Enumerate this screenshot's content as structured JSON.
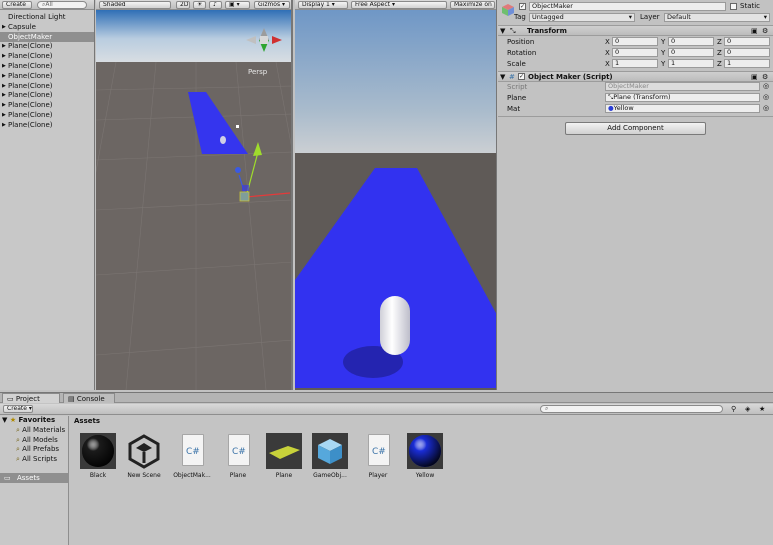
{
  "hierarchy": {
    "create_label": "Create",
    "search_placeholder": "All",
    "items": [
      {
        "label": "Directional Light",
        "arrow": ""
      },
      {
        "label": "Capsule",
        "arrow": "▶"
      },
      {
        "label": "ObjectMaker",
        "arrow": ""
      },
      {
        "label": "Plane(Clone)",
        "arrow": "▶"
      },
      {
        "label": "Plane(Clone)",
        "arrow": "▶"
      },
      {
        "label": "Plane(Clone)",
        "arrow": "▶"
      },
      {
        "label": "Plane(Clone)",
        "arrow": "▶"
      },
      {
        "label": "Plane(Clone)",
        "arrow": "▶"
      },
      {
        "label": "Plane(Clone)",
        "arrow": "▶"
      },
      {
        "label": "Plane(Clone)",
        "arrow": "▶"
      },
      {
        "label": "Plane(Clone)",
        "arrow": "▶"
      },
      {
        "label": "Plane(Clone)",
        "arrow": "▶"
      }
    ]
  },
  "scene": {
    "shading": "Shaded",
    "mode2d": "2D",
    "gizmos": "Gizmos",
    "persp": "Persp"
  },
  "game": {
    "display": "Display 1",
    "aspect": "Free Aspect",
    "maximize": "Maximize on P"
  },
  "inspector": {
    "object_name": "ObjectMaker",
    "static_label": "Static",
    "tag_label": "Tag",
    "tag_value": "Untagged",
    "layer_label": "Layer",
    "layer_value": "Default",
    "transform": {
      "title": "Transform",
      "position": {
        "label": "Position",
        "x": "0",
        "y": "0",
        "z": "0"
      },
      "rotation": {
        "label": "Rotation",
        "x": "0",
        "y": "0",
        "z": "0"
      },
      "scale": {
        "label": "Scale",
        "x": "1",
        "y": "1",
        "z": "1"
      }
    },
    "script_comp": {
      "title": "Object Maker (Script)",
      "script_label": "Script",
      "script_value": "ObjectMaker",
      "plane_label": "Plane",
      "plane_value": "Plane (Transform)",
      "mat_label": "Mat",
      "mat_value": "Yellow"
    },
    "add_component": "Add Component"
  },
  "project": {
    "tab_project": "Project",
    "tab_console": "Console",
    "create_label": "Create",
    "favorites_title": "Favorites",
    "favorites": [
      "All Materials",
      "All Models",
      "All Prefabs",
      "All Scripts"
    ],
    "assets_folder": "Assets",
    "breadcrumb": "Assets",
    "assets": [
      {
        "name": "Black",
        "kind": "sphere",
        "color": "#1b1b1b"
      },
      {
        "name": "New Scene",
        "kind": "unity"
      },
      {
        "name": "ObjectMak...",
        "kind": "script"
      },
      {
        "name": "Plane",
        "kind": "script"
      },
      {
        "name": "Plane",
        "kind": "plane"
      },
      {
        "name": "GameObj...",
        "kind": "cube"
      },
      {
        "name": "Player",
        "kind": "script"
      },
      {
        "name": "Yellow",
        "kind": "sphere",
        "color": "#1a2dd6"
      }
    ]
  },
  "colors": {
    "road": "#3232f0",
    "sky": "#7fa6cf",
    "ground": "#5f5a57"
  }
}
